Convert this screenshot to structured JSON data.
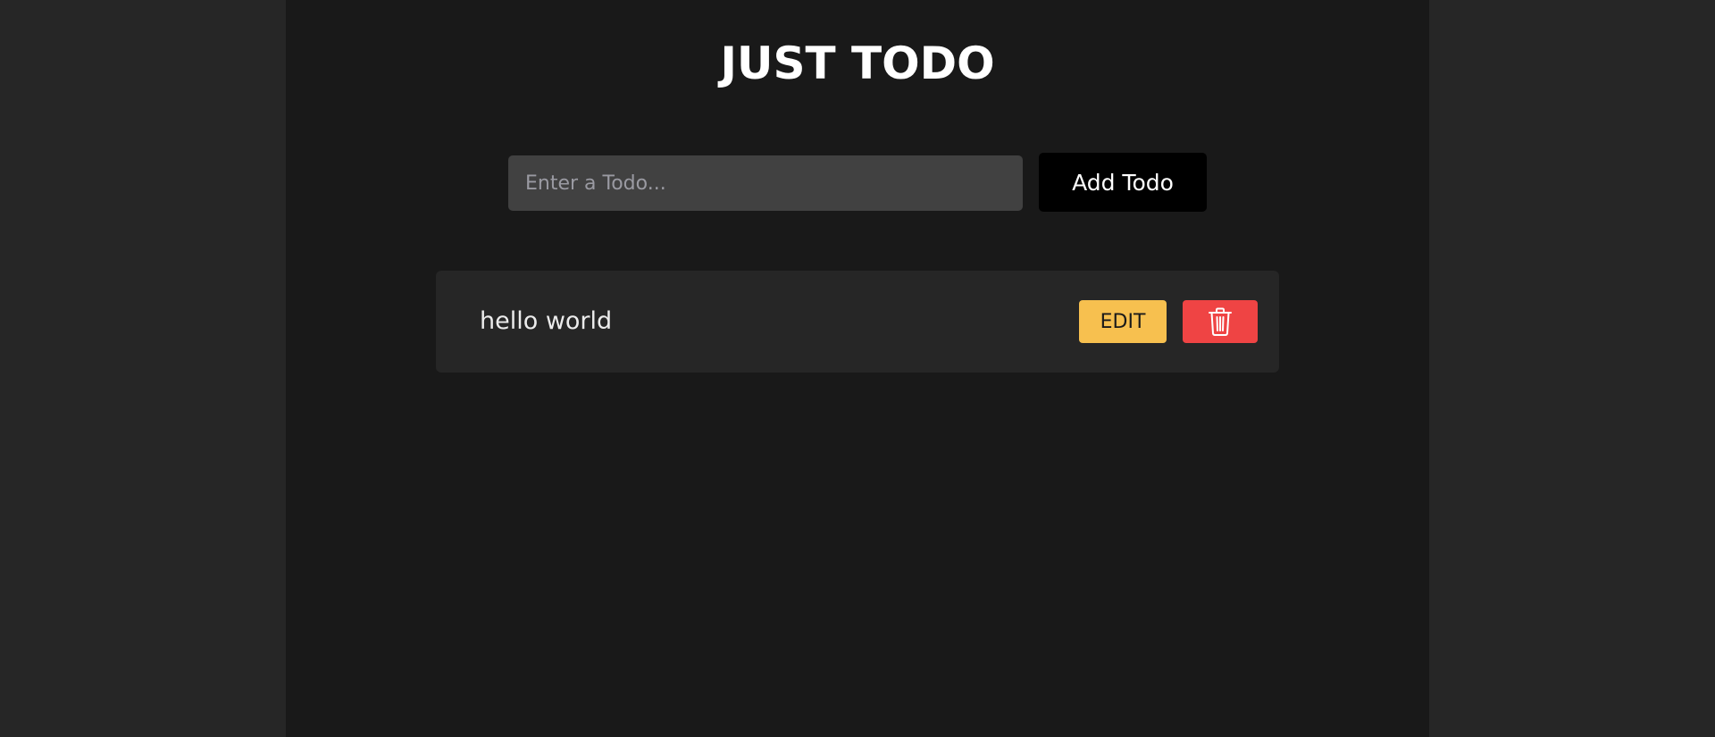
{
  "app": {
    "title": "JUST TODO"
  },
  "input": {
    "placeholder": "Enter a Todo...",
    "value": ""
  },
  "add_button": {
    "label": "Add Todo"
  },
  "todos": [
    {
      "text": "hello world",
      "edit_label": "EDIT",
      "delete_icon": "trash-icon"
    }
  ],
  "colors": {
    "page_background": "#262626",
    "app_background": "#191919",
    "input_background": "#414141",
    "add_button": "#000000",
    "todo_item_background": "#262626",
    "edit_button": "#f7c04f",
    "delete_button": "#ef4444"
  }
}
